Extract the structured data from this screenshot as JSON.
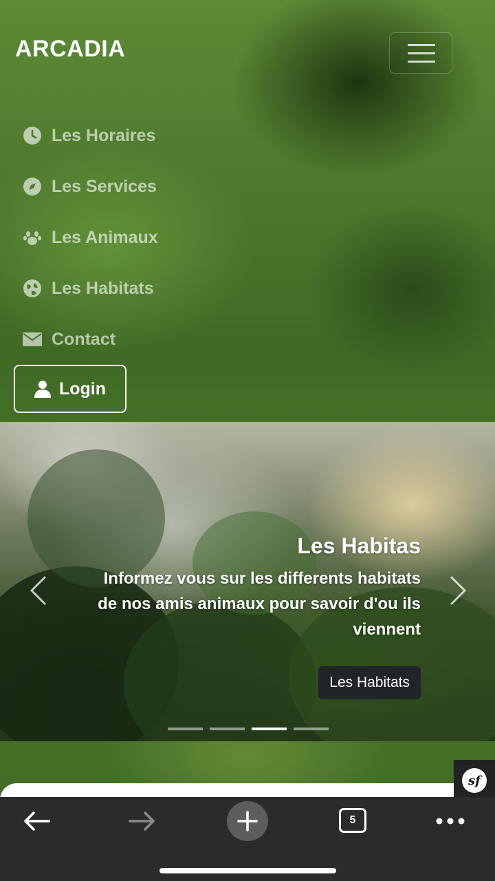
{
  "header": {
    "brand": "ARCADIA",
    "menu_toggle_icon": "hamburger-icon"
  },
  "nav": {
    "items": [
      {
        "label": "Les Horaires",
        "icon": "clock-icon"
      },
      {
        "label": "Les Services",
        "icon": "compass-icon"
      },
      {
        "label": "Les Animaux",
        "icon": "paw-icon"
      },
      {
        "label": "Les Habitats",
        "icon": "globe-icon"
      },
      {
        "label": "Contact",
        "icon": "envelope-icon"
      }
    ],
    "login": {
      "label": "Login",
      "icon": "user-icon"
    }
  },
  "carousel": {
    "title": "Les Habitas",
    "text": "Informez vous sur les differents habitats de nos amis animaux pour savoir d'ou ils viennent",
    "button_label": "Les Habitats",
    "slide_count": 4,
    "active_index": 2
  },
  "debug_badge": {
    "label": "sf"
  },
  "browser_toolbar": {
    "tab_count": "5",
    "icons": [
      "back-arrow-icon",
      "forward-arrow-icon",
      "new-tab-plus-icon",
      "tabs-icon",
      "more-dots-icon"
    ]
  },
  "colors": {
    "toolbar_bg": "#2b2b2b",
    "caption_button_bg": "#212529",
    "nav_text": "rgba(255,255,255,0.62)"
  }
}
